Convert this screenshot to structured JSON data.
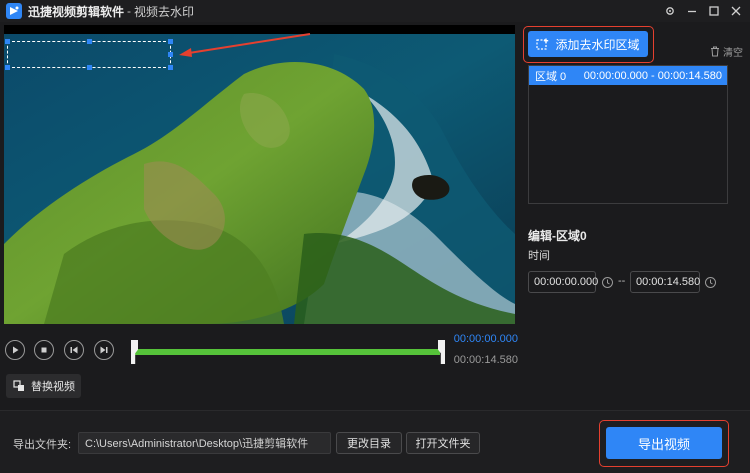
{
  "titlebar": {
    "app_name": "迅捷视频剪辑软件",
    "separator": "-",
    "subtitle": "视频去水印"
  },
  "player": {
    "current_time": "00:00:00.000",
    "total_time": "00:00:14.580",
    "replace_video_label": "替换视频"
  },
  "regions": {
    "add_region_label": "添加去水印区域",
    "clear_label": "清空",
    "items": [
      {
        "name": "区域 0",
        "range": "00:00:00.000 - 00:00:14.580"
      }
    ]
  },
  "editor": {
    "title": "编辑-区域0",
    "time_label": "时间",
    "start_time": "00:00:00.000",
    "dash": "--",
    "end_time": "00:00:14.580"
  },
  "export": {
    "folder_label": "导出文件夹:",
    "folder_path": "C:\\Users\\Administrator\\Desktop\\迅捷剪辑软件",
    "change_dir_label": "更改目录",
    "open_folder_label": "打开文件夹",
    "export_label": "导出视频"
  },
  "colors": {
    "accent": "#2f86f6",
    "progress": "#56c33a",
    "highlight": "#e5402f",
    "background": "#1b1b1d"
  }
}
